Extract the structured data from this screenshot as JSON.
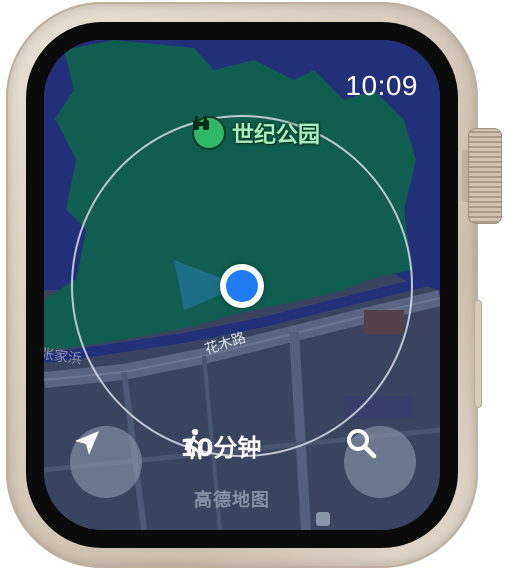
{
  "status_bar": {
    "time": "10:09"
  },
  "map": {
    "poi": {
      "name": "世纪公园",
      "icon": "binoculars-icon"
    },
    "streets": [
      "花木路",
      "张家浜"
    ],
    "walk_radius_label": "10分钟",
    "brand": "高德地图",
    "colors": {
      "park": "#0f5e50",
      "water": "#22307a",
      "road": "#4a5572",
      "block": "#3b4560",
      "location": "#1f7cf2"
    }
  },
  "controls": {
    "locate_icon": "location-arrow-icon",
    "search_icon": "search-icon"
  }
}
